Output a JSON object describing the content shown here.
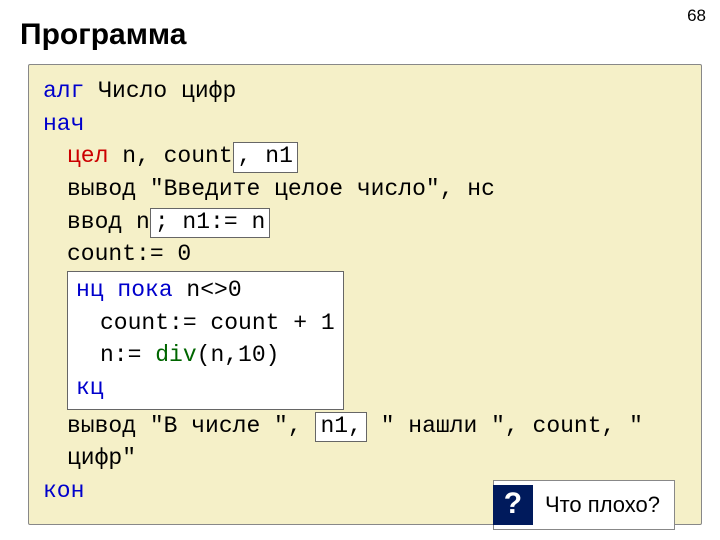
{
  "page_number": "68",
  "title": "Программа",
  "code": {
    "l1_alg": "алг",
    "l1_name": " Число цифр",
    "l2_begin": "нач",
    "l3_type": "цел",
    "l3_decl": " n, count",
    "l3_insert": ", n1",
    "l4_out": "вывод ",
    "l4_str": "\"Введите целое число\"",
    "l4_tail": ", нс",
    "l5_in": "ввод n",
    "l5_insert": "; n1:= n",
    "l6": "count:= 0",
    "blk_b1a": "нц пока",
    "blk_b1b": " n<>0",
    "blk_b2": "count:= count + 1",
    "blk_b3a": "n:= ",
    "blk_b3b": "div",
    "blk_b3c": "(n,10)",
    "blk_b4": "кц",
    "l8a": "вывод ",
    "l8b": "\"В числе \"",
    "l8c": ", ",
    "l8_insert": "n1,",
    "l8d": " \" нашли \"",
    "l8e": ", count, ",
    "l8f": "\" цифр\"",
    "l9": "кон"
  },
  "question_mark": "?",
  "question_text": "Что плохо?"
}
